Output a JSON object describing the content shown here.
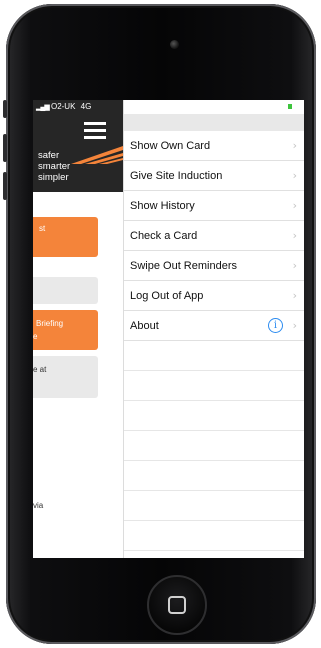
{
  "status_bar": {
    "carrier": "O2-UK",
    "network": "4G"
  },
  "app_header": {
    "brand_lines": [
      "safer",
      "smarter",
      "simpler"
    ]
  },
  "underlying_page": {
    "blocks": [
      {
        "text": "st",
        "style": "orange"
      },
      {
        "text": "",
        "style": "grey"
      },
      {
        "text": "Briefing\ne",
        "style": "orange"
      },
      {
        "text": "e at",
        "style": "grey"
      }
    ],
    "footer_text": "via"
  },
  "menu": {
    "items": [
      {
        "label": "Show Own Card"
      },
      {
        "label": "Give Site Induction"
      },
      {
        "label": "Show History"
      },
      {
        "label": "Check a Card"
      },
      {
        "label": "Swipe Out Reminders"
      },
      {
        "label": "Log Out of App"
      },
      {
        "label": "About"
      }
    ],
    "chevron": "›",
    "info_glyph": "i"
  },
  "colors": {
    "accent_orange": "#f4843a",
    "header_dark": "#262626",
    "info_blue": "#2d8cf0"
  }
}
